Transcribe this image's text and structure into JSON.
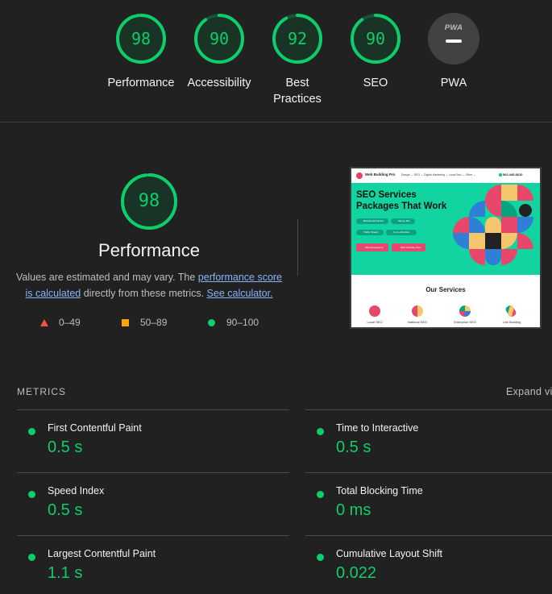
{
  "categories": [
    {
      "label": "Performance",
      "score": "98"
    },
    {
      "label": "Accessibility",
      "score": "90"
    },
    {
      "label": "Best Practices",
      "score": "92"
    },
    {
      "label": "SEO",
      "score": "90"
    },
    {
      "label": "PWA",
      "score": "PWA"
    }
  ],
  "performance": {
    "score": "98",
    "title": "Performance",
    "desc_part1": "Values are estimated and may vary. The ",
    "desc_link1": "performance score is calculated",
    "desc_part2": " directly from these metrics. ",
    "desc_link2": "See calculator.",
    "legend": [
      {
        "range": "0–49",
        "color": "#ff4e42"
      },
      {
        "range": "50–89",
        "color": "#ffa400"
      },
      {
        "range": "90–100",
        "color": "#0cce6b"
      }
    ]
  },
  "thumbnail": {
    "brand": "Web Building Pro",
    "menu": "Design ⌄    SEO ⌄    Digital Marketing ⌄    Local Seo ⌄    Other ⌄",
    "phone": "562.446.6610",
    "headline": "SEO Services Packages That Work",
    "pills": [
      "Behavioral Factors",
      "Money Bot",
      "Traffic Stream",
      "Conv. Direction"
    ],
    "buttons": [
      "SEO Reorganize",
      "SEO Website Pros"
    ],
    "services_title": "Our Services",
    "services": [
      "Local SEO",
      "National SEO",
      "Enterprise SEO",
      "Link Building"
    ]
  },
  "metrics": {
    "header": "METRICS",
    "expand": "Expand view",
    "items": [
      {
        "name": "First Contentful Paint",
        "value": "0.5 s"
      },
      {
        "name": "Time to Interactive",
        "value": "0.5 s"
      },
      {
        "name": "Speed Index",
        "value": "0.5 s"
      },
      {
        "name": "Total Blocking Time",
        "value": "0 ms"
      },
      {
        "name": "Largest Contentful Paint",
        "value": "1.1 s"
      },
      {
        "name": "Cumulative Layout Shift",
        "value": "0.022"
      }
    ]
  },
  "colors": {
    "pass": "#0cce6b",
    "average": "#ffa400",
    "fail": "#ff4e42",
    "link": "#8ab4f8"
  }
}
